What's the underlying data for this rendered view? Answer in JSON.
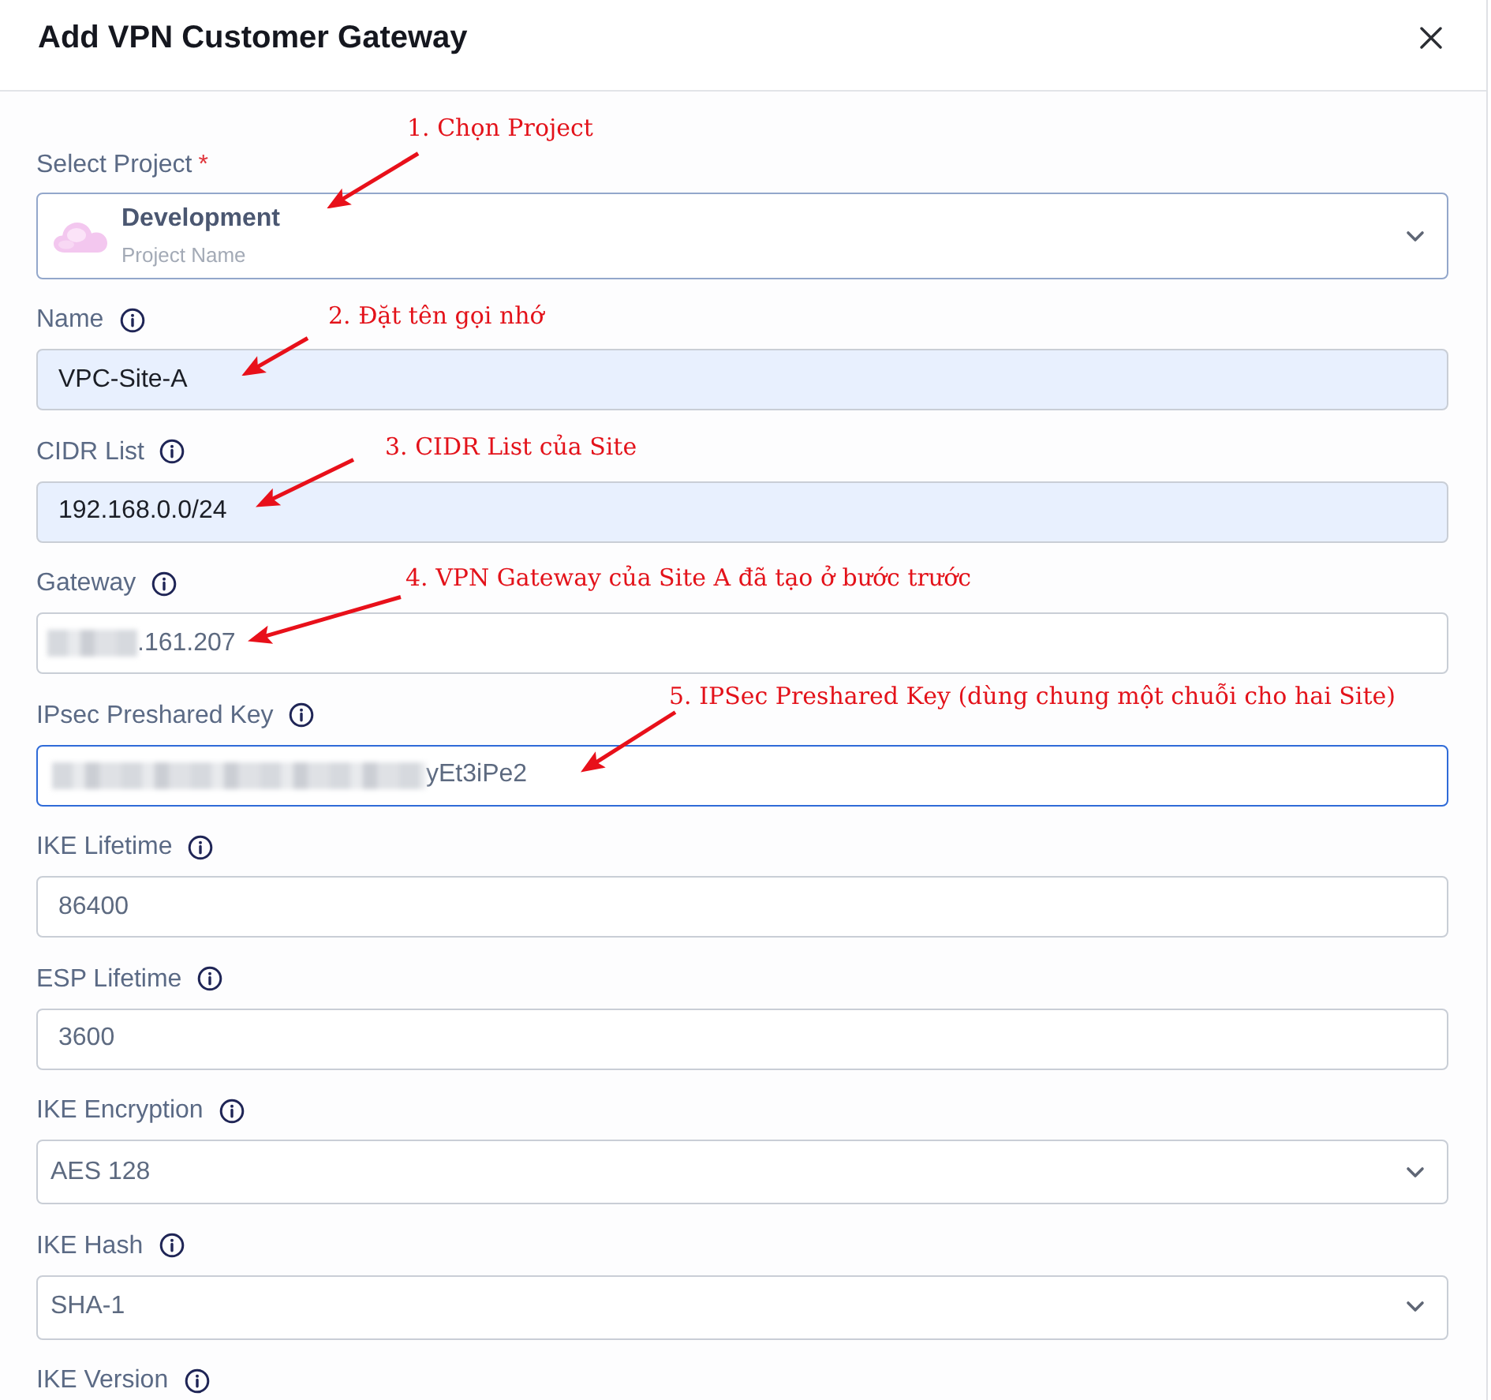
{
  "dialog": {
    "title": "Add VPN Customer Gateway"
  },
  "required_mark": "*",
  "fields": [
    {
      "kind": "project",
      "label": "Select Project",
      "required": true,
      "info": false,
      "value": "Development",
      "caption": "Project Name",
      "annotation": "1. Chọn Project"
    },
    {
      "kind": "text",
      "label": "Name",
      "required": false,
      "info": true,
      "value": "VPC-Site-A",
      "autofilled": true,
      "focused": false,
      "redacted": false,
      "annotation": "2. Đặt tên gọi nhớ"
    },
    {
      "kind": "text",
      "label": "CIDR List",
      "required": false,
      "info": true,
      "value": "192.168.0.0/24",
      "autofilled": true,
      "focused": false,
      "redacted": false,
      "annotation": "3. CIDR List của Site"
    },
    {
      "kind": "text",
      "label": "Gateway",
      "required": false,
      "info": true,
      "value": ".161.207",
      "autofilled": false,
      "focused": false,
      "redacted": true,
      "annotation": "4. VPN Gateway của Site A đã tạo ở bước trước"
    },
    {
      "kind": "text",
      "label": "IPsec Preshared Key",
      "required": false,
      "info": true,
      "value": "yEt3iPe2",
      "autofilled": false,
      "focused": true,
      "redacted": true,
      "annotation": "5. IPSec Preshared Key (dùng chung một chuỗi cho hai Site)"
    },
    {
      "kind": "text",
      "label": "IKE Lifetime",
      "required": false,
      "info": true,
      "value": "86400",
      "autofilled": false,
      "focused": false,
      "redacted": false
    },
    {
      "kind": "text",
      "label": "ESP Lifetime",
      "required": false,
      "info": true,
      "value": "3600",
      "autofilled": false,
      "focused": false,
      "redacted": false
    },
    {
      "kind": "select",
      "label": "IKE Encryption",
      "required": false,
      "info": true,
      "value": "AES 128"
    },
    {
      "kind": "select",
      "label": "IKE Hash",
      "required": false,
      "info": true,
      "value": "SHA-1"
    },
    {
      "kind": "label",
      "label": "IKE Version",
      "required": false,
      "info": true
    }
  ]
}
